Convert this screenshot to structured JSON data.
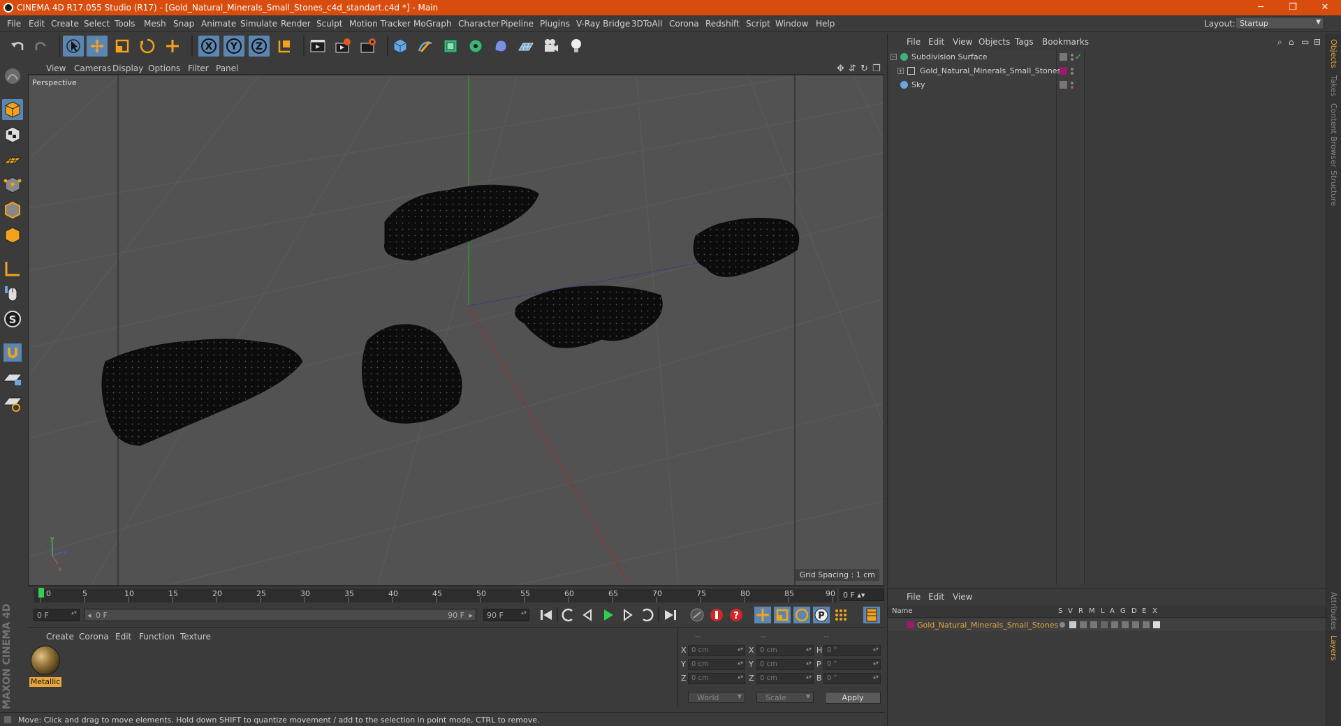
{
  "window": {
    "title": "CINEMA 4D R17.055 Studio (R17) - [Gold_Natural_Minerals_Small_Stones_c4d_standart.c4d *] - Main",
    "minimize": "─",
    "restore": "❐",
    "close": "✕"
  },
  "menubar": {
    "items": [
      "File",
      "Edit",
      "Create",
      "Select",
      "Tools",
      "Mesh",
      "Snap",
      "Animate",
      "Simulate",
      "Render",
      "Sculpt",
      "Motion Tracker",
      "MoGraph",
      "Character",
      "Pipeline",
      "Plugins",
      "V-Ray Bridge",
      "3DToAll",
      "Corona",
      "Redshift",
      "Script",
      "Window",
      "Help"
    ],
    "layout_label": "Layout:",
    "layout_value": "Startup"
  },
  "toolbar": {
    "icons": [
      "undo-icon",
      "redo-icon",
      "select-arrow-icon",
      "move-icon",
      "scale-icon",
      "rotate-icon",
      "live-select-icon",
      "x-axis-icon",
      "y-axis-icon",
      "z-axis-icon",
      "coordinate-system-icon",
      "render-view-icon",
      "render-picture-viewer-icon",
      "edit-render-settings-icon",
      "cube-icon",
      "spline-pen-icon",
      "subdivision-icon",
      "array-icon",
      "deformer-icon",
      "floor-icon",
      "camera-icon",
      "light-icon"
    ],
    "axis_x": "X",
    "axis_y": "Y",
    "axis_z": "Z"
  },
  "viewport": {
    "menu": [
      "View",
      "Cameras",
      "Display",
      "Options",
      "Filter",
      "Panel"
    ],
    "label": "Perspective",
    "grid_spacing": "Grid Spacing : 1 cm"
  },
  "timeline": {
    "ticks": [
      "0",
      "5",
      "10",
      "15",
      "20",
      "25",
      "30",
      "35",
      "40",
      "45",
      "50",
      "55",
      "60",
      "65",
      "70",
      "75",
      "80",
      "85",
      "90"
    ],
    "current_frame": "0 F",
    "start_frame": "0 F",
    "range_start": "0 F",
    "range_end": "90 F",
    "end_frame": "90 F"
  },
  "material_panel": {
    "menu": [
      "Create",
      "Corona",
      "Edit",
      "Function",
      "Texture"
    ],
    "material_name": "Metallic"
  },
  "coordinates": {
    "header": [
      "--",
      "--",
      "--"
    ],
    "rows": [
      {
        "l1": "X",
        "v1": "0 cm",
        "l2": "X",
        "v2": "0 cm",
        "l3": "H",
        "v3": "0 °"
      },
      {
        "l1": "Y",
        "v1": "0 cm",
        "l2": "Y",
        "v2": "0 cm",
        "l3": "P",
        "v3": "0 °"
      },
      {
        "l1": "Z",
        "v1": "0 cm",
        "l2": "Z",
        "v2": "0 cm",
        "l3": "B",
        "v3": "0 °"
      }
    ],
    "space": "World",
    "mode": "Scale",
    "apply": "Apply"
  },
  "status": "Move: Click and drag to move elements. Hold down SHIFT to quantize movement / add to the selection in point mode, CTRL to remove.",
  "maxon": "MAXON CINEMA 4D",
  "objects_panel": {
    "menu": [
      "File",
      "Edit",
      "View",
      "Objects",
      "Tags",
      "Bookmarks"
    ],
    "objects": [
      {
        "name": "Subdivision Surface",
        "indent": 0
      },
      {
        "name": "Gold_Natural_Minerals_Small_Stones",
        "indent": 1
      },
      {
        "name": "Sky",
        "indent": 0
      }
    ]
  },
  "layers_panel": {
    "menu": [
      "File",
      "Edit",
      "View"
    ],
    "columns": [
      "Name",
      "S",
      "V",
      "R",
      "M",
      "L",
      "A",
      "G",
      "D",
      "E",
      "X"
    ],
    "layer_name": "Gold_Natural_Minerals_Small_Stones"
  },
  "side_tabs": [
    "Objects",
    "Takes",
    "Content Browser",
    "Structure",
    "Attributes",
    "Layers"
  ],
  "colors": {
    "accent": "#d84c0e",
    "selected": "#5b86b2",
    "material_label": "#e7a53b",
    "layer_color": "#a0186e"
  }
}
